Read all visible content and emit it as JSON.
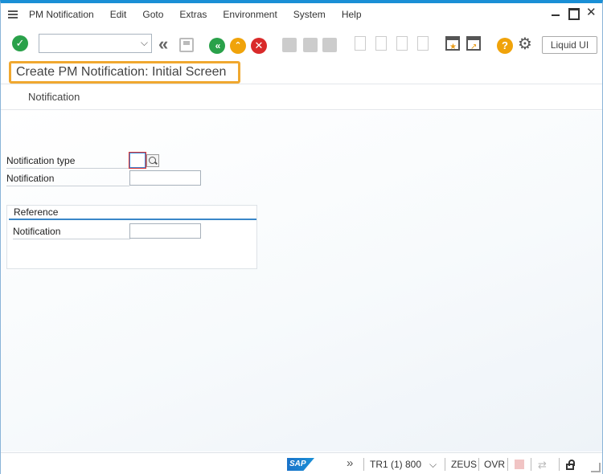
{
  "menubar": {
    "items": [
      "PM Notification",
      "Edit",
      "Goto",
      "Extras",
      "Environment",
      "System",
      "Help"
    ]
  },
  "window": {
    "minimize": "▁",
    "maximize": "□",
    "close": "✕"
  },
  "toolbar": {
    "ok_glyph": "✓",
    "command_value": "",
    "back_glyph": "«",
    "liquid_ui_label": "Liquid UI",
    "help_glyph": "?",
    "gear_glyph": "⚙",
    "icons": {
      "ok": "checkmark-icon",
      "back": "double-chevron-left-icon",
      "save": "save-icon",
      "green_back": "back-icon",
      "exit": "exit-icon",
      "cancel": "cancel-icon",
      "print": "print-icon",
      "find": "find-icon",
      "find_next": "find-next-icon",
      "first_page": "first-page-icon",
      "prev_page": "previous-page-icon",
      "next_page": "next-page-icon",
      "last_page": "last-page-icon",
      "new_session": "new-session-icon",
      "shortcut": "create-shortcut-icon",
      "help": "help-icon",
      "settings": "gear-icon"
    }
  },
  "screen": {
    "title": "Create PM Notification: Initial Screen",
    "subtoolbar_button": "Notification"
  },
  "form": {
    "notification_type_label": "Notification type",
    "notification_type_value": "",
    "notification_label": "Notification",
    "notification_value": "",
    "reference_group_title": "Reference",
    "reference_notification_label": "Notification",
    "reference_notification_value": ""
  },
  "statusbar": {
    "logo_text": "SAP",
    "system": "TR1 (1) 800",
    "chevron": "⌵",
    "user": "ZEUS",
    "mode": "OVR",
    "more_glyph": "»",
    "swap_glyph": "⇄"
  },
  "colors": {
    "accent_top": "#1a8fd6",
    "title_highlight": "#f0a830",
    "ok_green": "#2aa14a",
    "cancel_red": "#d92a2a",
    "exit_yellow": "#f0a30a"
  }
}
